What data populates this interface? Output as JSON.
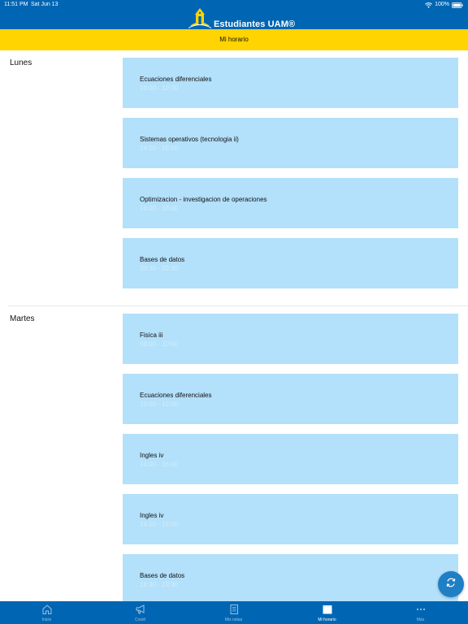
{
  "status": {
    "time": "11:51 PM",
    "date": "Sat Jun 13",
    "battery": "100%"
  },
  "app": {
    "brand_name": "Estudiantes UAM®",
    "page_title": "Mi horario"
  },
  "schedule": [
    {
      "day": "Lunes",
      "classes": [
        {
          "name": "Ecuaciones diferenciales",
          "time": "10:00 - 12:00"
        },
        {
          "name": "Sistemas operativos (tecnologia ii)",
          "time": "14:00 - 16:00"
        },
        {
          "name": "Optimizacion - investigacion de operaciones",
          "time": "16:00 - 18:00"
        },
        {
          "name": "Bases de datos",
          "time": "20:30 - 22:30"
        }
      ]
    },
    {
      "day": "Martes",
      "classes": [
        {
          "name": "Fisica iii",
          "time": "08:00 - 10:00"
        },
        {
          "name": "Ecuaciones diferenciales",
          "time": "10:00 - 12:00"
        },
        {
          "name": "Ingles iv",
          "time": "14:00 - 16:00"
        },
        {
          "name": "Ingles iv",
          "time": "14:00 - 16:00"
        },
        {
          "name": "Bases de datos",
          "time": "18:30 - 19:30"
        }
      ]
    }
  ],
  "tabs": [
    {
      "label": "Inicio",
      "icon": "home-icon",
      "active": false
    },
    {
      "label": "Covid",
      "icon": "megaphone-icon",
      "active": false
    },
    {
      "label": "Mis notas",
      "icon": "notes-icon",
      "active": false
    },
    {
      "label": "Mi horario",
      "icon": "calendar-icon",
      "active": true
    },
    {
      "label": "Más",
      "icon": "more-icon",
      "active": false
    }
  ],
  "colors": {
    "header_blue": "#0066b3",
    "title_yellow": "#ffd400",
    "card_blue": "#b3e0fa",
    "fab_blue": "#1f7fc5"
  }
}
